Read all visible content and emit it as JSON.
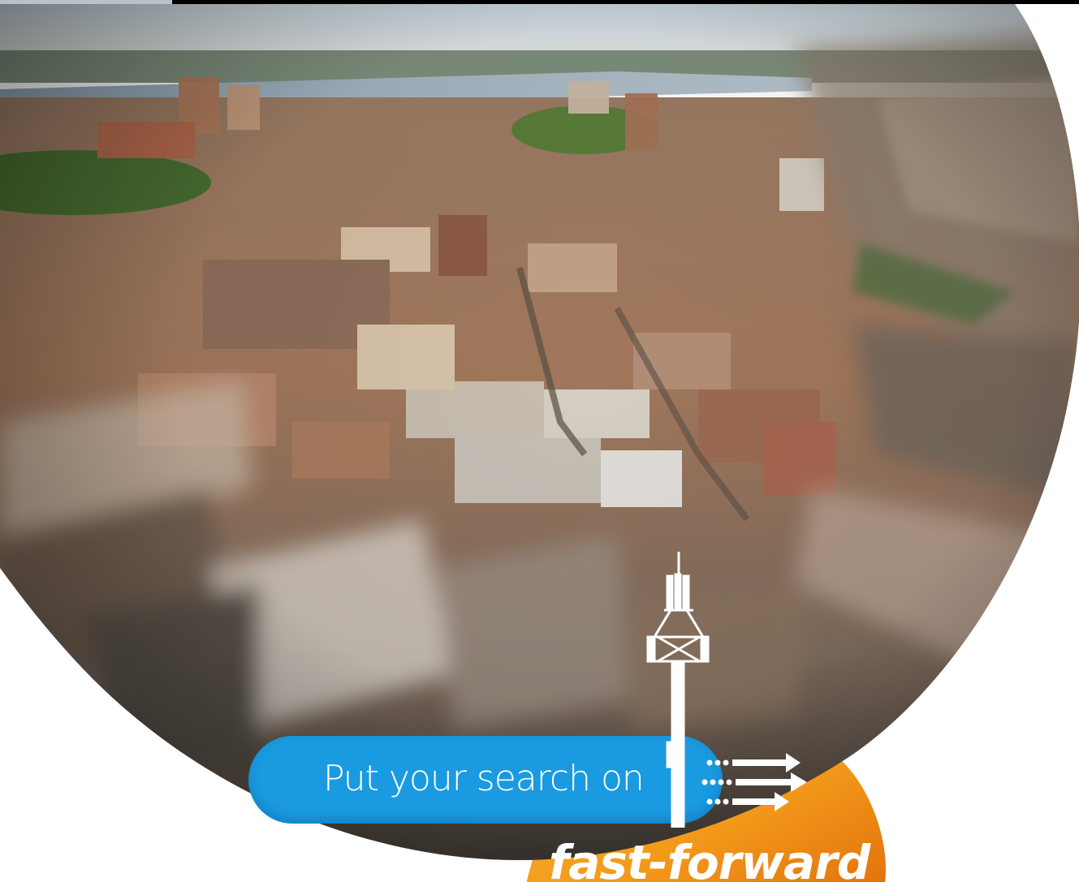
{
  "ad": {
    "headline": "Put your search on",
    "tagline": "fast-forward"
  },
  "icons": {
    "tower": "cell-tower-icon",
    "arrows": "fast-forward-arrows-icon"
  },
  "colors": {
    "pill": "#1a9ae0",
    "orange": "#f39a1a",
    "orange_dark": "#e06d0c",
    "top_bar": "#000000",
    "top_tab": "#b9c2c9"
  }
}
